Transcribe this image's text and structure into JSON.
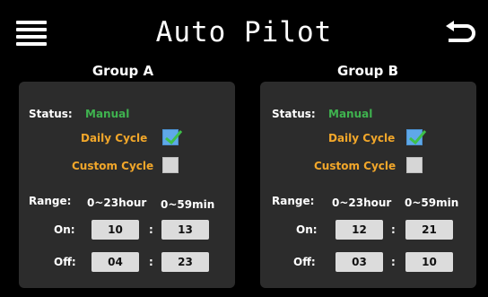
{
  "header": {
    "title": "Auto Pilot",
    "menu_icon": "hamburger-menu-icon",
    "back_icon": "back-arrow-icon"
  },
  "colors": {
    "background": "#000000",
    "panel": "#2c2c2c",
    "status_green": "#3fb34f",
    "cycle_orange": "#f2a72a",
    "checkbox_checked": "#5fa8e8",
    "checkmark_green": "#3ec04a",
    "input_box": "#dcdcdc"
  },
  "groups": [
    {
      "title": "Group A",
      "status_label": "Status:",
      "status_value": "Manual",
      "daily_cycle_label": "Daily Cycle",
      "daily_cycle_checked": true,
      "custom_cycle_label": "Custom Cycle",
      "custom_cycle_checked": false,
      "range_label": "Range:",
      "range_hours": "0~23hour",
      "range_minutes": "0~59min",
      "on_label": "On:",
      "on_hour": "10",
      "on_minute": "13",
      "off_label": "Off:",
      "off_hour": "04",
      "off_minute": "23",
      "colon": ":"
    },
    {
      "title": "Group B",
      "status_label": "Status:",
      "status_value": "Manual",
      "daily_cycle_label": "Daily Cycle",
      "daily_cycle_checked": true,
      "custom_cycle_label": "Custom Cycle",
      "custom_cycle_checked": false,
      "range_label": "Range:",
      "range_hours": "0~23hour",
      "range_minutes": "0~59min",
      "on_label": "On:",
      "on_hour": "12",
      "on_minute": "21",
      "off_label": "Off:",
      "off_hour": "03",
      "off_minute": "10",
      "colon": ":"
    }
  ]
}
